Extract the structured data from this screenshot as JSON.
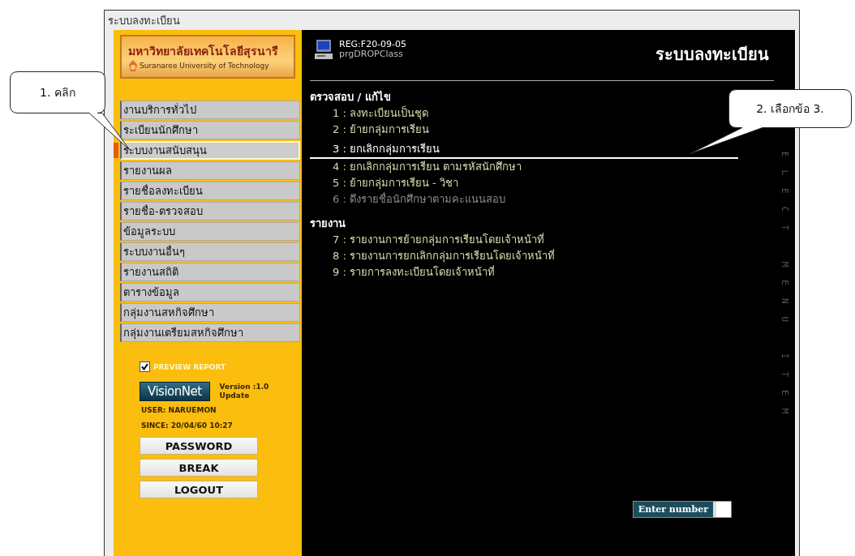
{
  "window": {
    "title": "ระบบลงทะเบียน"
  },
  "sidebar": {
    "logo": {
      "name_th": "มหาวิทยาลัยเทคโนโลยีสุรนารี",
      "name_en": "Suranaree University of Technology"
    },
    "menu": [
      {
        "label": "งานบริการทั่วไป",
        "selected": false
      },
      {
        "label": "ระเบียนนักศึกษา",
        "selected": false
      },
      {
        "label": "ระบบงานสนับสนุน",
        "selected": true
      },
      {
        "label": "รายงานผล",
        "selected": false
      },
      {
        "label": "รายชื่อลงทะเบียน",
        "selected": false
      },
      {
        "label": "รายชื่อ-ตรวจสอบ",
        "selected": false
      },
      {
        "label": "ข้อมูลระบบ",
        "selected": false
      },
      {
        "label": "ระบบงานอื่นๆ",
        "selected": false
      },
      {
        "label": "รายงานสถิติ",
        "selected": false
      },
      {
        "label": "ตารางข้อมูล",
        "selected": false
      },
      {
        "label": "กลุ่มงานสหกิจศึกษา",
        "selected": false
      },
      {
        "label": "กลุ่มงานเตรียมสหกิจศึกษา",
        "selected": false
      }
    ],
    "preview_report": {
      "label": "PREVIEW REPORT",
      "checked": true
    },
    "brand": "VisionNet",
    "version": "Version :1.0",
    "update": "Update",
    "user": "USER: NARUEMON",
    "since": "SINCE: 20/04/60 10:27",
    "buttons": [
      "PASSWORD",
      "BREAK",
      "LOGOUT"
    ]
  },
  "main": {
    "program_code": "REG:F20-09-05",
    "program_name": "prgDROPClass",
    "title": "ระบบลงทะเบียน",
    "sections": [
      {
        "heading": "ตรวจสอบ /  แก้ไข",
        "items": [
          {
            "text": "1 : ลงทะเบียนเป็นชุด",
            "selected": false,
            "disabled": false
          },
          {
            "text": "2 : ย้ายกลุ่มการเรียน",
            "selected": false,
            "disabled": false
          },
          {
            "text": "3 : ยกเลิกกลุ่มการเรียน",
            "selected": true,
            "disabled": false
          },
          {
            "text": "4 : ยกเลิกกลุ่มการเรียน  ตามรหัสนักศึกษา",
            "selected": false,
            "disabled": false
          },
          {
            "text": "5 : ย้ายกลุ่มการเรียน - วิชา",
            "selected": false,
            "disabled": false
          },
          {
            "text": "6 : ดึงรายชื่อนักศึกษาตามคะแนนสอบ",
            "selected": false,
            "disabled": true
          }
        ]
      },
      {
        "heading": "รายงาน",
        "items": [
          {
            "text": "7 : รายงานการย้ายกลุ่มการเรียนโดยเจ้าหน้าที่",
            "selected": false,
            "disabled": false
          },
          {
            "text": "8 : รายงานการยกเลิกกลุ่มการเรียนโดยเจ้าหน้าที่",
            "selected": false,
            "disabled": false
          },
          {
            "text": "9 : รายการลงทะเบียนโดยเจ้าหน้าที่",
            "selected": false,
            "disabled": false
          }
        ]
      }
    ],
    "side_text": "ELECT MENU ITEM",
    "entry": {
      "label": "Enter number"
    }
  },
  "callouts": [
    {
      "text": "1. คลิก"
    },
    {
      "text": "2. เลือกข้อ 3."
    }
  ]
}
